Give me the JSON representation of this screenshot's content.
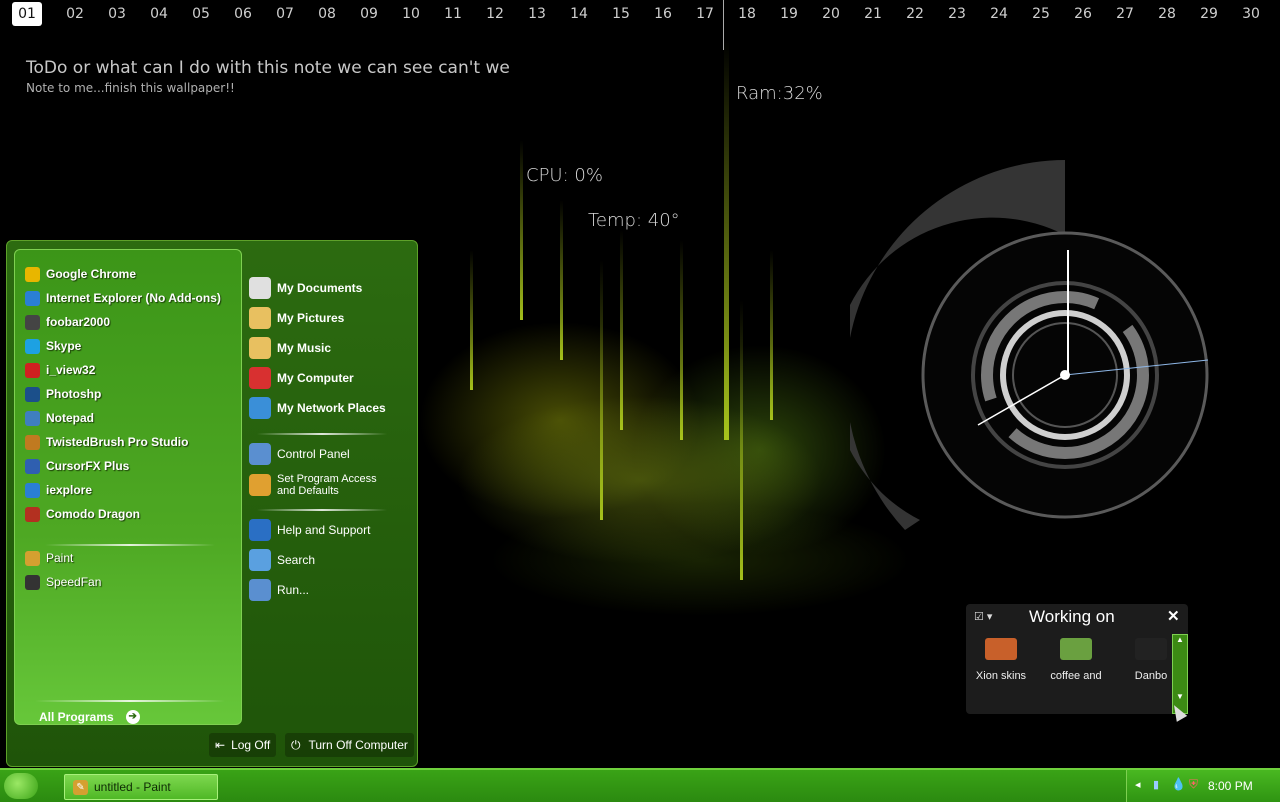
{
  "calendar": {
    "days": [
      "01",
      "02",
      "03",
      "04",
      "05",
      "06",
      "07",
      "08",
      "09",
      "10",
      "11",
      "12",
      "13",
      "14",
      "15",
      "16",
      "17",
      "18",
      "19",
      "20",
      "21",
      "22",
      "23",
      "24",
      "25",
      "26",
      "27",
      "28",
      "29",
      "30"
    ],
    "today": "01"
  },
  "note": {
    "title": "ToDo or what can I do with this note we can see can't we",
    "subtitle": "Note to me...finish this wallpaper!!"
  },
  "meters": {
    "ram": "Ram:32%",
    "cpu": "CPU: 0%",
    "temp": "Temp: 40°"
  },
  "start_menu": {
    "pinned": [
      {
        "label": "Google Chrome",
        "icon": "chrome-icon",
        "color": "#e8b600"
      },
      {
        "label": "Internet Explorer (No Add-ons)",
        "icon": "internet-explorer-icon",
        "color": "#2a7fd4"
      },
      {
        "label": "foobar2000",
        "icon": "foobar-icon",
        "color": "#444444"
      },
      {
        "label": "Skype",
        "icon": "skype-icon",
        "color": "#1da1e2"
      },
      {
        "label": "i_view32",
        "icon": "irfanview-icon",
        "color": "#d02020"
      },
      {
        "label": "Photoshp",
        "icon": "photoshop-icon",
        "color": "#1b4f8a"
      },
      {
        "label": "Notepad",
        "icon": "notepad-icon",
        "color": "#3f7fbf"
      },
      {
        "label": "TwistedBrush Pro Studio",
        "icon": "brush-icon",
        "color": "#c07a20"
      },
      {
        "label": "CursorFX Plus",
        "icon": "cursor-icon",
        "color": "#2f5fb0"
      },
      {
        "label": "iexplore",
        "icon": "iexplore-icon",
        "color": "#2a7fd4"
      },
      {
        "label": "Comodo Dragon",
        "icon": "comodo-icon",
        "color": "#b33020"
      }
    ],
    "recent": [
      {
        "label": "Paint",
        "icon": "paint-icon",
        "color": "#d4a030"
      },
      {
        "label": "SpeedFan",
        "icon": "speedfan-icon",
        "color": "#333333"
      }
    ],
    "all_programs": "All Programs",
    "places": [
      {
        "label": "My Documents",
        "icon": "my-documents-icon",
        "color": "#e0e0e0"
      },
      {
        "label": "My Pictures",
        "icon": "my-pictures-icon",
        "color": "#e8c060"
      },
      {
        "label": "My Music",
        "icon": "my-music-icon",
        "color": "#e8c060"
      },
      {
        "label": "My Computer",
        "icon": "my-computer-icon",
        "color": "#d83030"
      },
      {
        "label": "My Network Places",
        "icon": "network-places-icon",
        "color": "#3a8fd8"
      }
    ],
    "system": [
      {
        "label": "Control Panel",
        "icon": "control-panel-icon",
        "color": "#5a8fd0"
      },
      {
        "label": "Set Program Access and Defaults",
        "icon": "program-access-icon",
        "color": "#e0a030"
      }
    ],
    "help": [
      {
        "label": "Help and Support",
        "icon": "help-icon",
        "color": "#2a6fc4"
      },
      {
        "label": "Search",
        "icon": "search-icon",
        "color": "#5aa0e0"
      },
      {
        "label": "Run...",
        "icon": "run-icon",
        "color": "#5a8fd0"
      }
    ],
    "log_off": "Log Off",
    "turn_off": "Turn Off Computer"
  },
  "widget": {
    "title": "Working on",
    "items": [
      {
        "label": "Xion skins",
        "color": "#c8602a"
      },
      {
        "label": "coffee and",
        "color": "#6aa040"
      },
      {
        "label": "Danbo",
        "color": "#222222"
      }
    ]
  },
  "taskbar": {
    "task": "untitled - Paint",
    "time": "8:00 PM"
  }
}
